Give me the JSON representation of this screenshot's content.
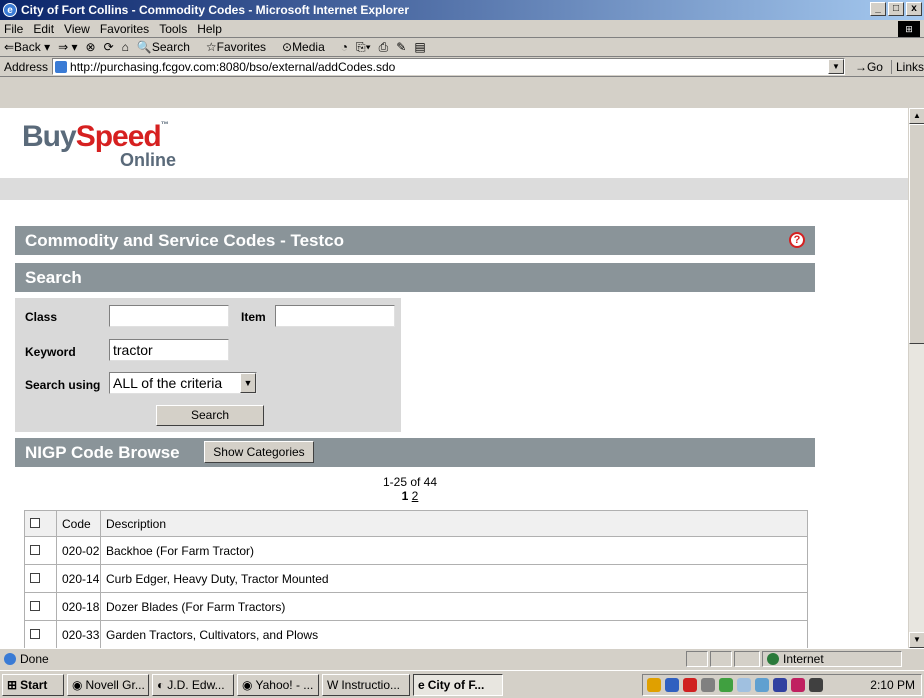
{
  "window": {
    "title": "City of Fort Collins - Commodity Codes - Microsoft Internet Explorer",
    "controls": [
      "_",
      "□",
      "x"
    ]
  },
  "menu": [
    "File",
    "Edit",
    "View",
    "Favorites",
    "Tools",
    "Help"
  ],
  "toolbar": {
    "back": "⇐Back ▾",
    "forward": "⇒ ▾",
    "stop": "⊗",
    "refresh": "⟳",
    "home": "⌂",
    "search": "Search",
    "favorites": "Favorites",
    "media": "Media",
    "history": "◔",
    "mail": "⎘▾",
    "print": "⎙",
    "edit": "✎",
    "discuss": "▤"
  },
  "address": {
    "label": "Address",
    "url": "http://purchasing.fcgov.com:8080/bso/external/addCodes.sdo",
    "go": "Go",
    "links": "Links"
  },
  "logo": {
    "buy": "Buy",
    "speed": "Speed",
    "tm": "™",
    "online": "Online"
  },
  "page_header": {
    "title": "Commodity and Service Codes - Testco",
    "help": "?"
  },
  "search": {
    "title": "Search",
    "class_label": "Class",
    "class_value": "",
    "item_label": "Item",
    "item_value": "",
    "keyword_label": "Keyword",
    "keyword_value": "tractor",
    "using_label": "Search using",
    "using_value": "ALL of the criteria",
    "button": "Search"
  },
  "browse": {
    "title": "NIGP Code Browse",
    "show_categories": "Show Categories"
  },
  "pager": {
    "range": "1-25 of 44",
    "current": "1",
    "next": "2"
  },
  "table": {
    "headers": [
      "",
      "Code",
      "Description"
    ],
    "rows": [
      {
        "code": "020-02",
        "description": "Backhoe (For Farm Tractor)"
      },
      {
        "code": "020-14",
        "description": "Curb Edger, Heavy Duty, Tractor Mounted"
      },
      {
        "code": "020-18",
        "description": "Dozer Blades (For Farm Tractors)"
      },
      {
        "code": "020-33",
        "description": "Garden Tractors, Cultivators, and Plows"
      }
    ]
  },
  "status": {
    "text": "Done",
    "zone": "Internet"
  },
  "taskbar": {
    "start": "Start",
    "tasks": [
      "Novell Gr...",
      "J.D. Edw...",
      "Yahoo! - ...",
      "Instructio...",
      "City of F..."
    ],
    "clock": "2:10 PM"
  }
}
